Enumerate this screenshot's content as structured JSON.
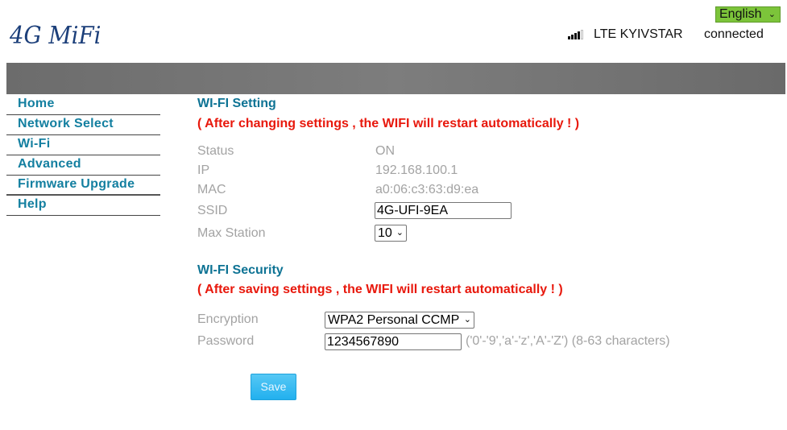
{
  "header": {
    "logo": "4G MiFi",
    "language": "English",
    "network": "LTE KYIVSTAR",
    "connection_status": "connected",
    "signal_bars_filled": 4,
    "signal_bars_total": 5
  },
  "sidebar": {
    "items": [
      {
        "label": "Home"
      },
      {
        "label": "Network Select"
      },
      {
        "label": "Wi-Fi"
      },
      {
        "label": "Advanced"
      },
      {
        "label": "Firmware Upgrade"
      },
      {
        "label": "Help"
      }
    ]
  },
  "wifi_setting": {
    "title": "WI-FI Setting",
    "warning": "( After changing settings , the WIFI will restart automatically ! )",
    "status_label": "Status",
    "status_value": "ON",
    "ip_label": "IP",
    "ip_value": "192.168.100.1",
    "mac_label": "MAC",
    "mac_value": "a0:06:c3:63:d9:ea",
    "ssid_label": "SSID",
    "ssid_value": "4G-UFI-9EA",
    "max_station_label": "Max Station",
    "max_station_value": "10"
  },
  "wifi_security": {
    "title": "WI-FI Security",
    "warning": "( After saving settings , the WIFI will restart automatically ! )",
    "encryption_label": "Encryption",
    "encryption_value": "WPA2 Personal CCMP",
    "password_label": "Password",
    "password_value": "1234567890",
    "password_hint": "('0'-'9','a'-'z','A'-'Z') (8-63 characters)"
  },
  "actions": {
    "save_label": "Save"
  },
  "colors": {
    "nav": "#137fa0",
    "section_title": "#0e7394",
    "warning": "#e8180c",
    "language_bg": "#7cc43a",
    "save_button": "#22b0ee"
  }
}
